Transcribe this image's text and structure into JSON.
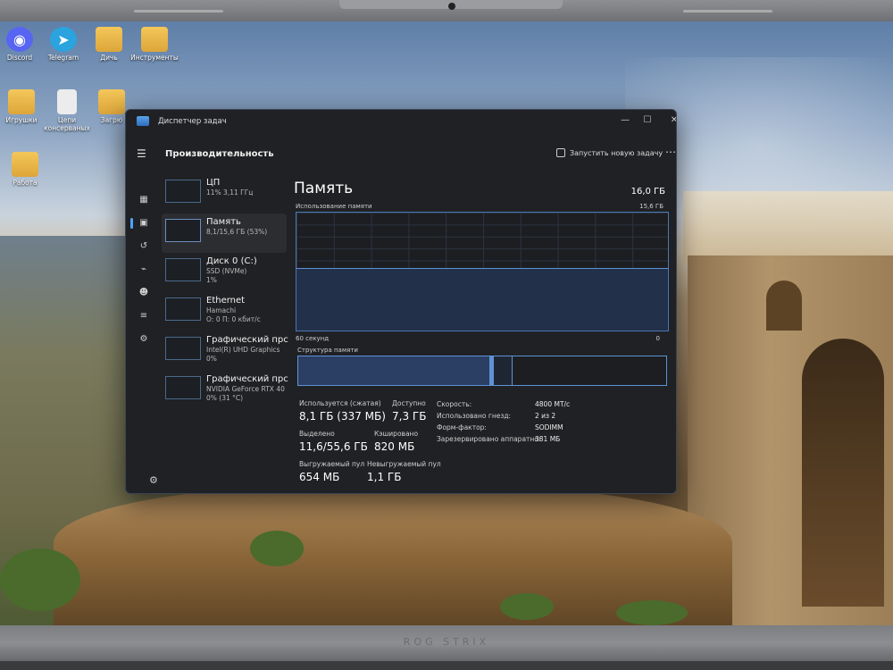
{
  "desktop": {
    "icons": [
      {
        "label": "Discord",
        "glyph": "discord-icon",
        "color": "#5865F2"
      },
      {
        "label": "Telegram",
        "glyph": "telegram-icon",
        "color": "#2AA3DF"
      },
      {
        "label": "Дичь",
        "glyph": "folder-icon",
        "color": "#E8B648"
      },
      {
        "label": "Инструменты",
        "glyph": "folder-icon",
        "color": "#E8B648"
      },
      {
        "label": "Игрушки",
        "glyph": "folder-icon",
        "color": "#E8B648"
      },
      {
        "label": "Цепи консерваныx",
        "glyph": "document-icon",
        "color": "#DDDDDD"
      },
      {
        "label": "Загрю",
        "glyph": "folder-icon",
        "color": "#E8B648"
      },
      {
        "label": "Работа",
        "glyph": "folder-icon",
        "color": "#E8B648"
      }
    ]
  },
  "window": {
    "title": "Диспетчер задач",
    "controls": {
      "minimize": "—",
      "maximize": "☐",
      "close": "✕"
    }
  },
  "header": {
    "menu_glyph": "☰",
    "page_title": "Производительность",
    "run_task_label": "Запустить новую задачу",
    "more_glyph": "⋯"
  },
  "nav_icons": [
    "processes-icon",
    "performance-icon",
    "history-icon",
    "startup-icon",
    "users-icon",
    "details-icon",
    "services-icon"
  ],
  "resources": [
    {
      "name": "ЦП",
      "line2": "11% 3,11 ГГц",
      "line3": "",
      "selected": false
    },
    {
      "name": "Память",
      "line2": "8,1/15,6 ГБ (53%)",
      "line3": "",
      "selected": true
    },
    {
      "name": "Диск 0 (C:)",
      "line2": "SSD (NVMe)",
      "line3": "1%",
      "selected": false
    },
    {
      "name": "Ethernet",
      "line2": "Hamachi",
      "line3": "О: 0 П: 0 кбит/с",
      "selected": false
    },
    {
      "name": "Графический прс",
      "line2": "Intel(R) UHD Graphics",
      "line3": "0%",
      "selected": false
    },
    {
      "name": "Графический прс",
      "line2": "NVIDIA GeForce RTX 40",
      "line3": "0% (31 °C)",
      "selected": false
    }
  ],
  "memory": {
    "title": "Память",
    "total": "16,0 ГБ",
    "usage_label": "Использование памяти",
    "usage_max": "15,6 ГБ",
    "usage_fraction": 0.53,
    "axis_left": "60 секунд",
    "axis_right": "0",
    "structure_label": "Структура памяти",
    "structure": [
      {
        "part": "in_use",
        "fraction": 0.52,
        "color": "#2b3e63"
      },
      {
        "part": "modified",
        "fraction": 0.01,
        "color": "#5f92d6"
      },
      {
        "part": "standby",
        "fraction": 0.05,
        "color": "#1f2633"
      },
      {
        "part": "free",
        "fraction": 0.42,
        "color": "#1c1e22"
      }
    ],
    "stats": {
      "in_use_label": "Используется (сжатая)",
      "in_use_value": "8,1 ГБ (337 МБ)",
      "available_label": "Доступно",
      "available_value": "7,3 ГБ",
      "committed_label": "Выделено",
      "committed_value": "11,6/55,6 ГБ",
      "cached_label": "Кэшировано",
      "cached_value": "820 МБ",
      "paged_label": "Выгружаемый пул",
      "paged_value": "654 МБ",
      "nonpaged_label": "Невыгружаемый пул",
      "nonpaged_value": "1,1 ГБ"
    },
    "specs": [
      {
        "label": "Скорость:",
        "value": "4800 МТ/с"
      },
      {
        "label": "Использовано гнезд:",
        "value": "2 из 2"
      },
      {
        "label": "Форм-фактор:",
        "value": "SODIMM"
      },
      {
        "label": "Зарезервировано аппаратно:",
        "value": "381 МБ"
      }
    ]
  },
  "laptop": {
    "brand": "ROG STRIX"
  }
}
